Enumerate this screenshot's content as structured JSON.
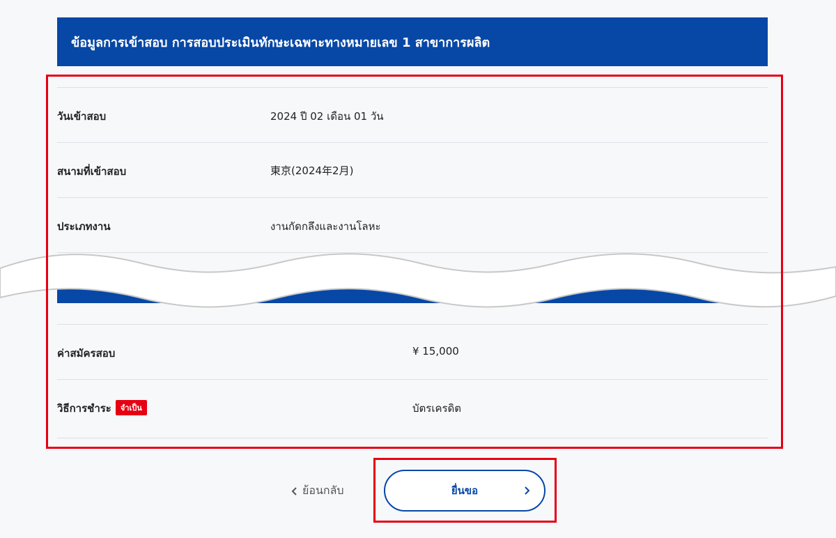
{
  "header": {
    "title": "ข้อมูลการเข้าสอบ การสอบประเมินทักษะเฉพาะทางหมายเลข 1 สาขาการผลิต"
  },
  "details": {
    "exam_date": {
      "label": "วันเข้าสอบ",
      "value": "2024 ปี 02 เดือน 01 วัน"
    },
    "exam_venue": {
      "label": "สนามที่เข้าสอบ",
      "value": "東京(2024年2月)"
    },
    "job_type": {
      "label": "ประเภทงาน",
      "value": "งานกัดกลึงและงานโลหะ"
    },
    "exam_fee": {
      "label": "ค่าสมัครสอบ",
      "value": "¥ 15,000"
    },
    "payment_method": {
      "label": "วิธีการชำระ",
      "required_badge": "จำเป็น",
      "value": "บัตรเครดิต"
    }
  },
  "actions": {
    "back_label": "ย้อนกลับ",
    "submit_label": "ยื่นขอ"
  },
  "colors": {
    "brand_blue": "#0747a6",
    "highlight_red": "#e60012",
    "background": "#f7f8fa"
  },
  "icons": {
    "back": "chevron-left-icon",
    "submit": "chevron-right-icon"
  }
}
